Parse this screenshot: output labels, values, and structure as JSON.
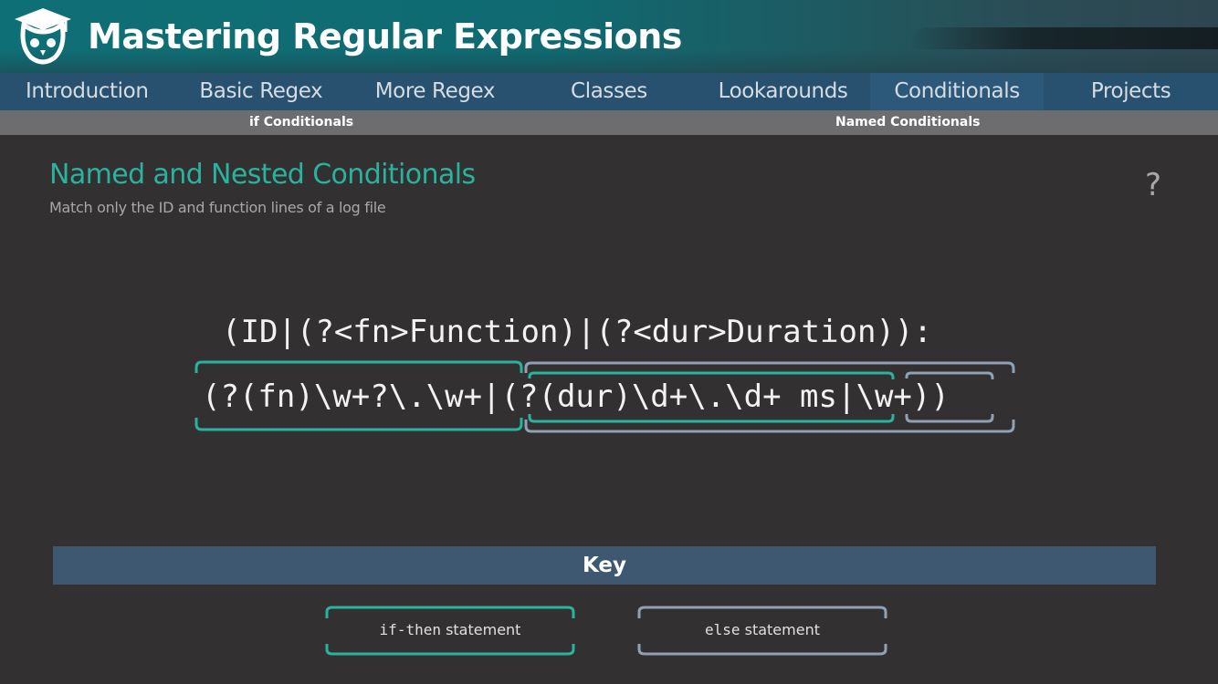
{
  "header": {
    "title": "Mastering Regular Expressions",
    "logo_icon": "graduation-cap-owl-icon"
  },
  "nav": {
    "items": [
      {
        "label": "Introduction"
      },
      {
        "label": "Basic Regex"
      },
      {
        "label": "More Regex"
      },
      {
        "label": "Classes"
      },
      {
        "label": "Lookarounds"
      },
      {
        "label": "Conditionals",
        "active": true
      },
      {
        "label": "Projects"
      }
    ]
  },
  "subnav": {
    "items": [
      {
        "label": "if Conditionals"
      },
      {
        "label": "Named Conditionals"
      }
    ]
  },
  "main": {
    "title": "Named and Nested Conditionals",
    "subtitle": "Match only the ID and function lines of a log file",
    "help": "?"
  },
  "regex": {
    "line1": "(ID|(?<fn>Function)|(?<dur>Duration)):",
    "line2_if": "(?(fn)\\w+?\\.\\w+",
    "line2_sep": "|",
    "line2_nested_if": "(?(dur)\\d+\\.\\d+ ms",
    "line2_sep2": "|",
    "line2_nested_else": "\\w+)",
    "line2_end": ")"
  },
  "key": {
    "title": "Key",
    "if_then_keyword": "if-then",
    "if_then_text": " statement",
    "else_keyword": "else",
    "else_text": " statement"
  },
  "colors": {
    "accent_teal": "#2ab39c",
    "else_gray": "#8fa1b3",
    "nav_bg": "#27516f",
    "key_bar": "#3e5871"
  }
}
